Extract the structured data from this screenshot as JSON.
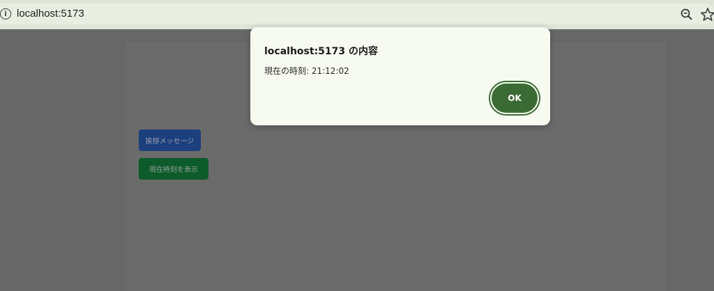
{
  "browser": {
    "url": "localhost:5173",
    "info_icon": "info-icon",
    "zoom_icon": "zoom-icon",
    "bookmark_icon": "star-icon"
  },
  "page": {
    "buttons": [
      {
        "label": "挨拶メッセージ"
      },
      {
        "label": "現在時刻を表示"
      }
    ]
  },
  "dialog": {
    "title": "localhost:5173 の内容",
    "message": "現在の時刻: 21:12:02",
    "ok_label": "OK"
  },
  "colors": {
    "overlay": "#676767",
    "dialog_bg": "#f7faf1",
    "ok_button": "#3b6b35",
    "greet_button": "#1c3f7e",
    "time_button": "#0d5a2a"
  }
}
